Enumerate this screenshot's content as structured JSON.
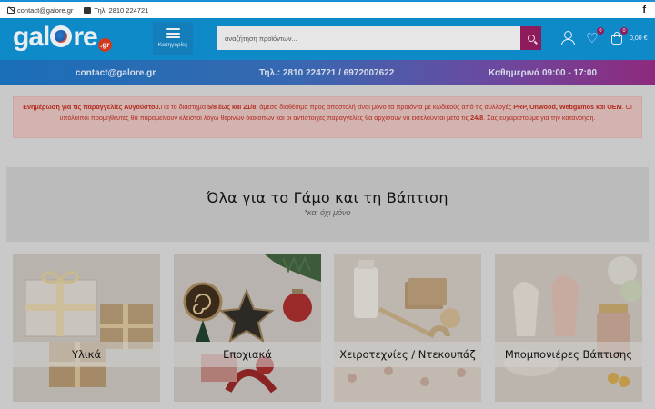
{
  "topbar": {
    "email": "contact@galore.gr",
    "phone": "Τηλ. 2810 224721",
    "social_icon": "f"
  },
  "header": {
    "logo_text": "gal",
    "logo_text_2": "re",
    "logo_badge": ".gr",
    "menu_label": "Κατηγορίες",
    "search_placeholder": "αναζήτηση προϊόντων...",
    "wishlist_count": "0",
    "cart_count": "0",
    "cart_total": "0,00 €"
  },
  "infobar": {
    "email": "contact@galore.gr",
    "phones": "Τηλ.: 2810 224721 / 6972007622",
    "hours": "Καθημερινά 09:00 - 17:00"
  },
  "notice": {
    "lead": "Ενημέρωση για τις παραγγελίες Αυγούστου.",
    "t1": "Για το διάστημα ",
    "dates": "5/8 έως και 21/8",
    "t2": ", άμεσα διαθέσιμα προς αποστολή είναι μόνο τα προϊόντα με κωδικούς από τις συλλογές ",
    "brands": "PRP, Onwood, Webgamos και OEM",
    "t3": ". Οι υπόλοιποι προμηθευτές θα παραμείνουν κλειστοί λόγω θερινών διακοπών και οι αντίστοιχες παραγγελίες θα αρχίσουν να εκτελούνται μετά τις ",
    "resume_date": "24/8",
    "t4": ". Σας ευχαριστούμε για την κατανόηση."
  },
  "banner": {
    "title": "Όλα για το Γάμο και τη Βάπτιση",
    "subtitle": "*και όχι μόνο"
  },
  "categories": [
    {
      "label": "Υλικά"
    },
    {
      "label": "Εποχιακά"
    },
    {
      "label": "Χειροτεχνίες / Ντεκουπάζ"
    },
    {
      "label": "Μπομπονιέρες Βάπτισης"
    }
  ],
  "colors": {
    "header_blue": "#0f8ac9",
    "accent_magenta": "#8e1b5b",
    "notice_text": "#b12a1f"
  }
}
